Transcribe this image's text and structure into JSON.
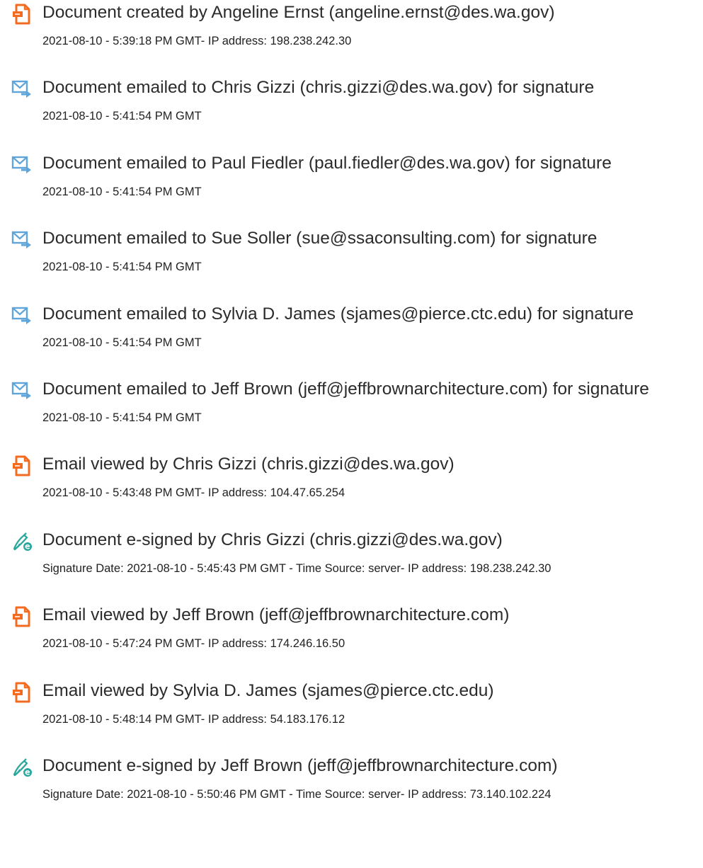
{
  "colors": {
    "doc_icon": "#f26b21",
    "email_icon": "#5fa5d9",
    "sign_icon": "#2aa89e",
    "text": "#2b2b2b"
  },
  "events": [
    {
      "icon": "document-icon",
      "title": "Document created by Angeline Ernst (angeline.ernst@des.wa.gov)",
      "detail": "2021-08-10 - 5:39:18 PM GMT- IP address: 198.238.242.30"
    },
    {
      "icon": "email-sent-icon",
      "title": "Document emailed to Chris Gizzi (chris.gizzi@des.wa.gov) for signature",
      "detail": "2021-08-10 - 5:41:54 PM GMT"
    },
    {
      "icon": "email-sent-icon",
      "title": "Document emailed to Paul Fiedler (paul.fiedler@des.wa.gov) for signature",
      "detail": "2021-08-10 - 5:41:54 PM GMT"
    },
    {
      "icon": "email-sent-icon",
      "title": "Document emailed to Sue Soller (sue@ssaconsulting.com) for signature",
      "detail": "2021-08-10 - 5:41:54 PM GMT"
    },
    {
      "icon": "email-sent-icon",
      "title": "Document emailed to Sylvia D. James (sjames@pierce.ctc.edu) for signature",
      "detail": "2021-08-10 - 5:41:54 PM GMT"
    },
    {
      "icon": "email-sent-icon",
      "title": "Document emailed to Jeff Brown (jeff@jeffbrownarchitecture.com) for signature",
      "detail": "2021-08-10 - 5:41:54 PM GMT"
    },
    {
      "icon": "document-icon",
      "title": "Email viewed by Chris Gizzi (chris.gizzi@des.wa.gov)",
      "detail": "2021-08-10 - 5:43:48 PM GMT- IP address: 104.47.65.254"
    },
    {
      "icon": "e-sign-icon",
      "title": "Document e-signed by Chris Gizzi (chris.gizzi@des.wa.gov)",
      "detail": "Signature Date: 2021-08-10 - 5:45:43 PM GMT - Time Source: server- IP address: 198.238.242.30"
    },
    {
      "icon": "document-icon",
      "title": "Email viewed by Jeff Brown (jeff@jeffbrownarchitecture.com)",
      "detail": "2021-08-10 - 5:47:24 PM GMT- IP address: 174.246.16.50"
    },
    {
      "icon": "document-icon",
      "title": "Email viewed by Sylvia D. James (sjames@pierce.ctc.edu)",
      "detail": "2021-08-10 - 5:48:14 PM GMT- IP address: 54.183.176.12"
    },
    {
      "icon": "e-sign-icon",
      "title": "Document e-signed by Jeff Brown (jeff@jeffbrownarchitecture.com)",
      "detail": "Signature Date: 2021-08-10 - 5:50:46 PM GMT - Time Source: server- IP address: 73.140.102.224"
    }
  ]
}
